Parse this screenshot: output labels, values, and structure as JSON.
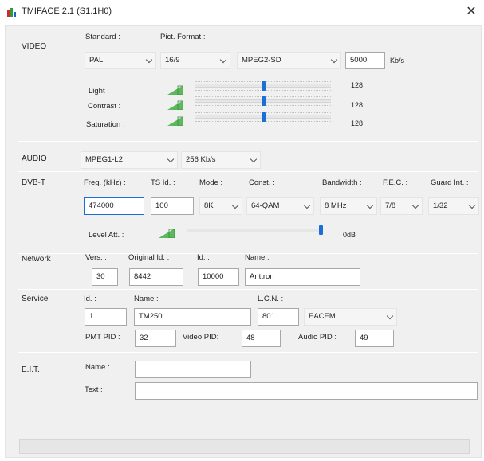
{
  "window": {
    "title": "TMIFACE 2.1 (S1.1H0)",
    "close_glyph": "✕",
    "icon": "bar-chart-icon",
    "icon_colors": [
      "#d62828",
      "#2a9d3e",
      "#1f5fd0"
    ]
  },
  "accent_color": "#1a6ed8",
  "video": {
    "section_label": "VIDEO",
    "standard_label": "Standard :",
    "standard_value": "PAL",
    "pict_format_label": "Pict. Format :",
    "pict_format_value": "16/9",
    "codec_value": "MPEG2-SD",
    "bitrate_value": "5000",
    "bitrate_unit": "Kb/s",
    "light_label": "Light :",
    "light_value": "128",
    "contrast_label": "Contrast :",
    "contrast_value": "128",
    "saturation_label": "Saturation :",
    "saturation_value": "128",
    "slider_level_fraction": 0.5
  },
  "audio": {
    "section_label": "AUDIO",
    "codec_value": "MPEG1-L2",
    "bitrate_value": "256 Kb/s"
  },
  "dvbt": {
    "section_label": "DVB-T",
    "freq_label": "Freq. (kHz) :",
    "freq_value": "474000",
    "ts_id_label": "TS Id. :",
    "ts_id_value": "100",
    "mode_label": "Mode :",
    "mode_value": "8K",
    "const_label": "Const. :",
    "const_value": "64-QAM",
    "bandwidth_label": "Bandwidth :",
    "bandwidth_value": "8 MHz",
    "fec_label": "F.E.C. :",
    "fec_value": "7/8",
    "guard_label": "Guard Int. :",
    "guard_value": "1/32",
    "level_att_label": "Level Att. :",
    "level_att_value": "0dB",
    "level_fraction": 1.0
  },
  "network": {
    "section_label": "Network",
    "vers_label": "Vers. :",
    "vers_value": "30",
    "orig_id_label": "Original Id. :",
    "orig_id_value": "8442",
    "id_label": "Id. :",
    "id_value": "10000",
    "name_label": "Name :",
    "name_value": "Anttron"
  },
  "service": {
    "section_label": "Service",
    "id_label": "Id. :",
    "id_value": "1",
    "name_label": "Name :",
    "name_value": "TM250",
    "lcn_label": "L.C.N. :",
    "lcn_value": "801",
    "lcn_type_value": "EACEM",
    "pmt_pid_label": "PMT PID :",
    "pmt_pid_value": "32",
    "video_pid_label": "Video PID:",
    "video_pid_value": "48",
    "audio_pid_label": "Audio PID :",
    "audio_pid_value": "49"
  },
  "eit": {
    "section_label": "E.I.T.",
    "name_label": "Name :",
    "name_value": "",
    "text_label": "Text :",
    "text_value": ""
  }
}
